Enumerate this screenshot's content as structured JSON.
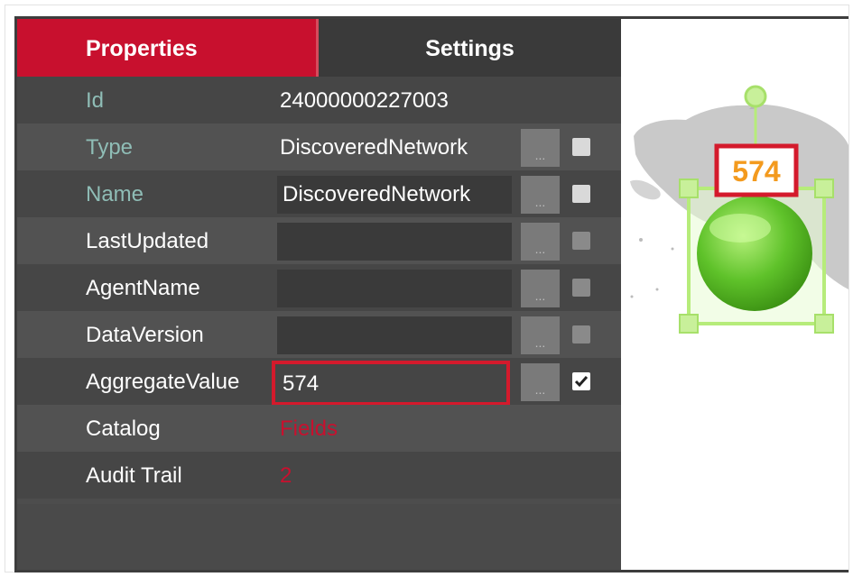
{
  "tabs": {
    "properties": "Properties",
    "settings": "Settings"
  },
  "rows": [
    {
      "label": "Id",
      "value": "24000000227003",
      "kind": "text",
      "label_color": "teal"
    },
    {
      "label": "Type",
      "value": "DiscoveredNetwork",
      "kind": "text-with-controls",
      "label_color": "teal",
      "checked": false
    },
    {
      "label": "Name",
      "value": "DiscoveredNetwork",
      "kind": "field",
      "label_color": "teal",
      "checked": false
    },
    {
      "label": "LastUpdated",
      "value": "",
      "kind": "field",
      "label_color": "white",
      "checked": false
    },
    {
      "label": "AgentName",
      "value": "",
      "kind": "field",
      "label_color": "white",
      "checked": false
    },
    {
      "label": "DataVersion",
      "value": "",
      "kind": "field",
      "label_color": "white",
      "checked": false
    },
    {
      "label": "AggregateValue",
      "value": "574",
      "kind": "field-highlight",
      "label_color": "white",
      "checked": true
    },
    {
      "label": "Catalog",
      "value": "Fields",
      "kind": "link",
      "label_color": "white"
    },
    {
      "label": "Audit Trail",
      "value": "2",
      "kind": "link",
      "label_color": "white"
    }
  ],
  "dots_label": "...",
  "canvas": {
    "node_label": "574",
    "node_color": "#5fc22a",
    "label_color": "#f39a1e",
    "highlight_color": "#d41a2c",
    "map_color": "#c9c9c9"
  },
  "colors": {
    "accent": "#c8102e",
    "panel": "#4d4d4d",
    "teal_label": "#8fbdb6"
  }
}
